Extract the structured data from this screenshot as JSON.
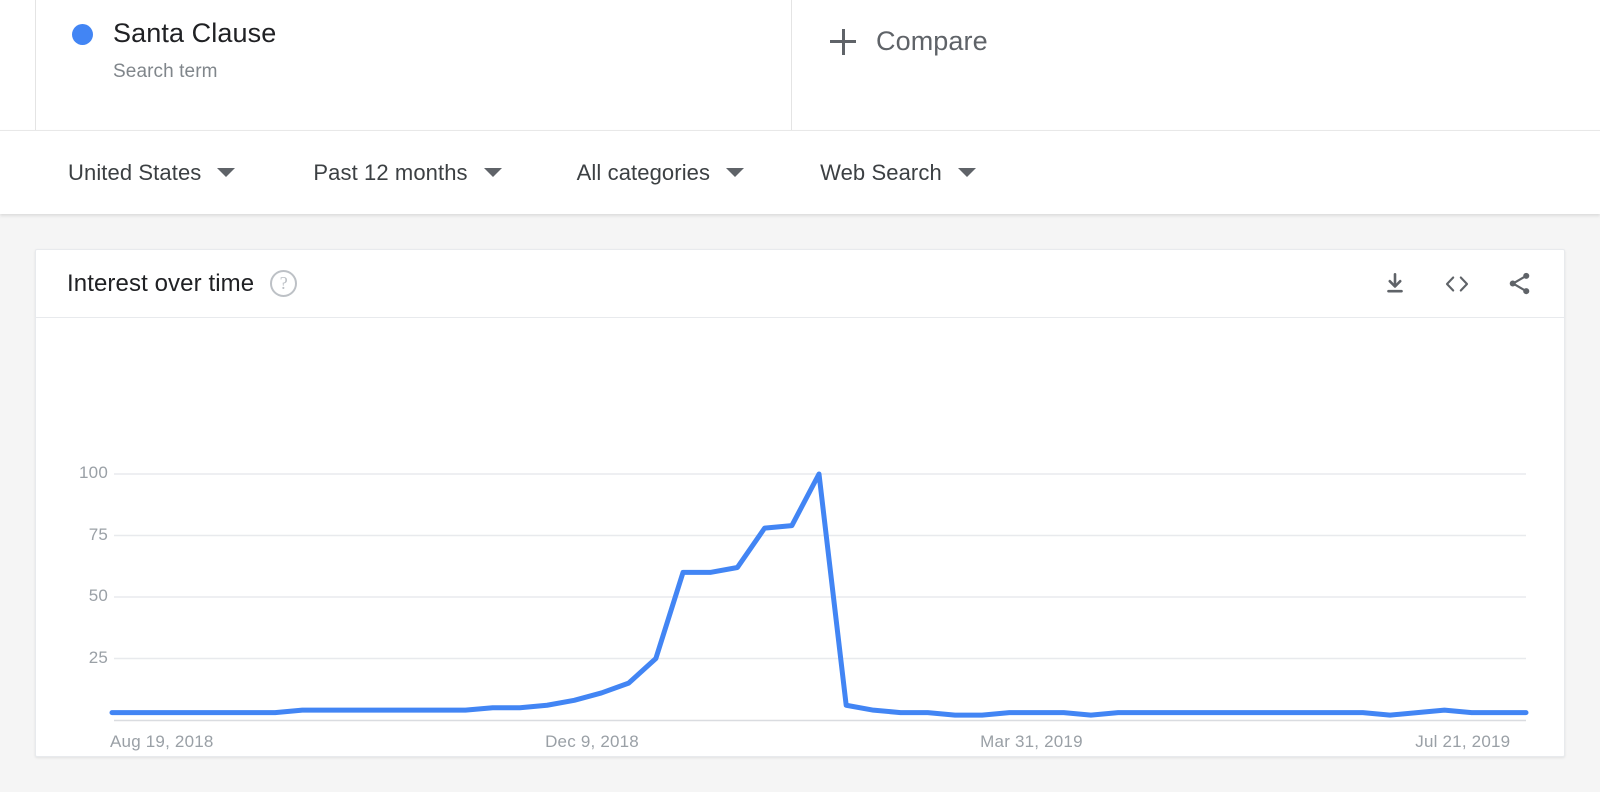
{
  "term": {
    "dot_color": "#4285f4",
    "title": "Santa Clause",
    "subtitle": "Search term"
  },
  "compare": {
    "label": "Compare",
    "icon": "plus-icon"
  },
  "filters": [
    {
      "label": "United States",
      "icon": "chevron-down-icon"
    },
    {
      "label": "Past 12 months",
      "icon": "chevron-down-icon"
    },
    {
      "label": "All categories",
      "icon": "chevron-down-icon"
    },
    {
      "label": "Web Search",
      "icon": "chevron-down-icon"
    }
  ],
  "card": {
    "title": "Interest over time",
    "help_icon": "?",
    "actions": [
      {
        "name": "download-icon",
        "tooltip": "Download"
      },
      {
        "name": "embed-code-icon",
        "tooltip": "Embed"
      },
      {
        "name": "share-icon",
        "tooltip": "Share"
      }
    ]
  },
  "chart_data": {
    "type": "line",
    "title": "Interest over time",
    "xlabel": "",
    "ylabel": "",
    "ylim": [
      0,
      100
    ],
    "yticks": [
      25,
      50,
      75,
      100
    ],
    "grid": true,
    "legend": "none",
    "line_color": "#4285f4",
    "xticks": [
      "Aug 19, 2018",
      "Dec 9, 2018",
      "Mar 31, 2019",
      "Jul 21, 2019"
    ],
    "xtick_positions": [
      0,
      0.3077,
      0.6154,
      0.9231
    ],
    "series": [
      {
        "name": "Santa Clause",
        "values": [
          3,
          3,
          3,
          3,
          3,
          3,
          3,
          4,
          4,
          4,
          4,
          4,
          4,
          4,
          5,
          5,
          6,
          8,
          11,
          15,
          25,
          60,
          60,
          62,
          78,
          79,
          100,
          6,
          4,
          3,
          3,
          2,
          2,
          3,
          3,
          3,
          2,
          3,
          3,
          3,
          3,
          3,
          3,
          3,
          3,
          3,
          3,
          2,
          3,
          4,
          3,
          3,
          3
        ]
      }
    ]
  }
}
